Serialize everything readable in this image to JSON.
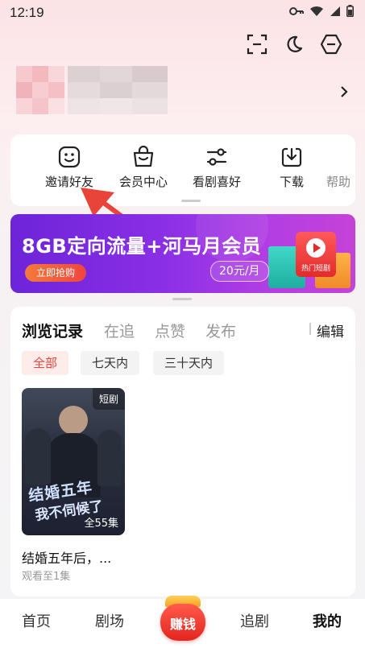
{
  "status": {
    "time": "12:19"
  },
  "quick_actions": [
    {
      "label": "邀请好友",
      "icon": "smile-face-icon"
    },
    {
      "label": "会员中心",
      "icon": "vip-bag-icon"
    },
    {
      "label": "看剧喜好",
      "icon": "preference-sliders-icon"
    },
    {
      "label": "下载",
      "icon": "download-icon"
    },
    {
      "label": "帮助",
      "icon": "help-icon"
    }
  ],
  "banner": {
    "title": "8GB定向流量+河马月会员",
    "button": "立即抢购",
    "price": "20元/月",
    "badge": "热门短剧"
  },
  "history": {
    "tabs": [
      "浏览记录",
      "在追",
      "点赞",
      "发布"
    ],
    "edit": "编辑",
    "filters": [
      "全部",
      "七天内",
      "三十天内"
    ],
    "items": [
      {
        "tag": "短剧",
        "episodes": "全55集",
        "title": "结婚五年后，...",
        "progress": "观看至1集",
        "poster_text_1": "结婚五年",
        "poster_text_2": "我不伺候了"
      }
    ]
  },
  "bottom_nav": {
    "home": "首页",
    "theater": "剧场",
    "earn": "赚钱",
    "follow": "追剧",
    "mine": "我的"
  },
  "colors": {
    "accent_red": "#e8443a",
    "banner_purple": "#7a2be0"
  }
}
